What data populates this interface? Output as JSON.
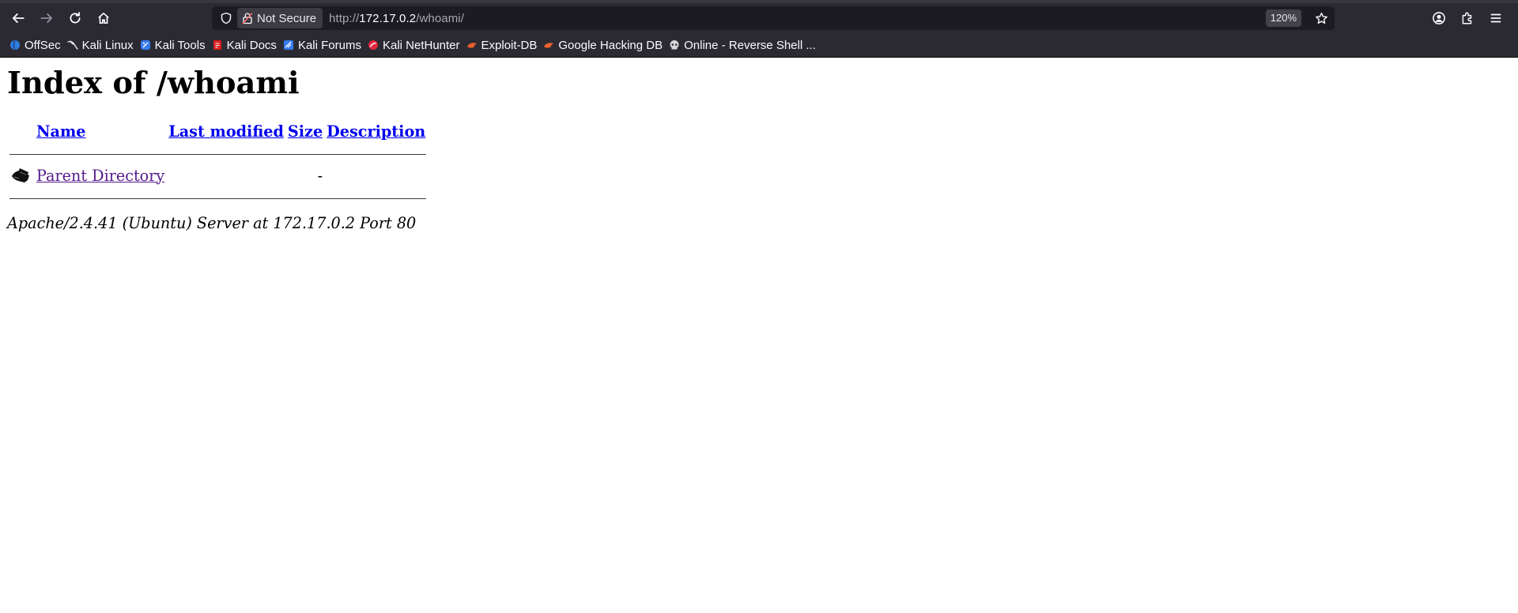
{
  "browser": {
    "url_scheme": "http://",
    "url_host": "172.17.0.2",
    "url_path": "/whoami/",
    "security_label": "Not Secure",
    "zoom": "120%",
    "bookmarks": [
      {
        "label": "OffSec",
        "icon": "offsec-icon",
        "color": "#2f7ee0"
      },
      {
        "label": "Kali Linux",
        "icon": "kali-dragon-icon",
        "color": "#e8e8ec"
      },
      {
        "label": "Kali Tools",
        "icon": "kali-tools-icon",
        "color": "#367bf0"
      },
      {
        "label": "Kali Docs",
        "icon": "kali-docs-icon",
        "color": "#d81e1e"
      },
      {
        "label": "Kali Forums",
        "icon": "kali-forums-icon",
        "color": "#367bf0"
      },
      {
        "label": "Kali NetHunter",
        "icon": "nethunter-icon",
        "color": "#e0263c"
      },
      {
        "label": "Exploit-DB",
        "icon": "exploit-db-icon",
        "color": "#e8602c"
      },
      {
        "label": "Google Hacking DB",
        "icon": "ghdb-icon",
        "color": "#e8602c"
      },
      {
        "label": "Online - Reverse Shell ...",
        "icon": "skull-icon",
        "color": "#d8d8d8"
      }
    ]
  },
  "page": {
    "title": "Index of /whoami",
    "columns": {
      "name": "Name",
      "last_modified": "Last modified",
      "size": "Size",
      "description": "Description"
    },
    "rows": [
      {
        "name": "Parent Directory",
        "last_modified": "",
        "size": "-",
        "description": "",
        "icon": "back-arrow-icon"
      }
    ],
    "footer": "Apache/2.4.41 (Ubuntu) Server at 172.17.0.2 Port 80"
  }
}
